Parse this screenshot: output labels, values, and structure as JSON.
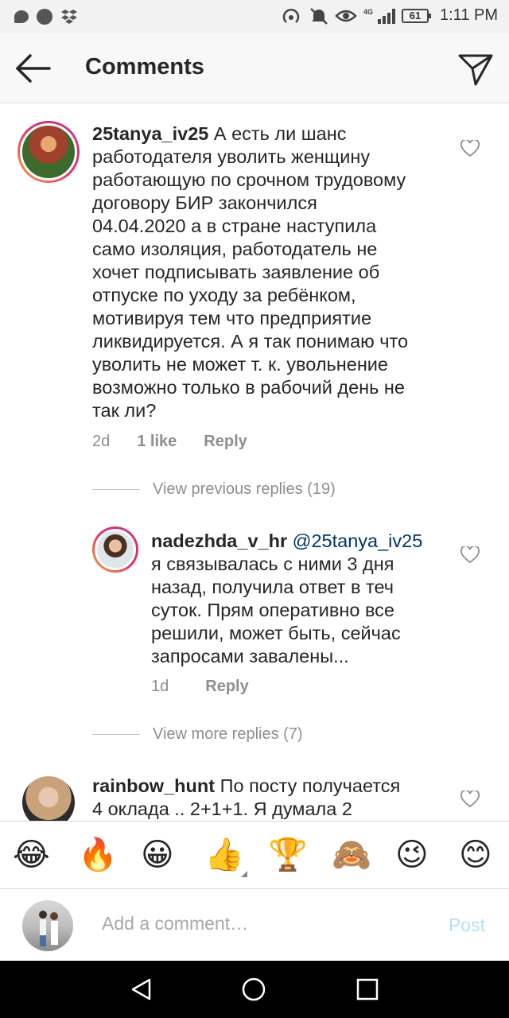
{
  "status_bar": {
    "time": "1:11 PM",
    "battery": "61",
    "network": "4G"
  },
  "header": {
    "title": "Comments",
    "back_icon": "arrow-left-icon",
    "send_icon": "paper-plane-icon"
  },
  "comments": [
    {
      "username": "25tanya_iv25",
      "text_lines": [
        "А есть ли шанс",
        "работодателя уволить женщину",
        "работающую по срочном трудовому",
        "договору БИР закончился",
        "04.04.2020 а в стране наступила",
        "само изоляция, работодатель не",
        "хочет подписывать заявление об",
        "отпуске  по уходу за ребёнком,",
        "мотивируя тем что предприятие",
        "ликвидируется. А я так понимаю что",
        "уволить не может т. к. увольнение",
        "возможно только в рабочий день не",
        "так ли?"
      ],
      "time": "2d",
      "likes": "1 like",
      "reply": "Reply"
    }
  ],
  "view_previous": "View previous replies (19)",
  "reply_comment": {
    "username": "nadezhda_v_hr",
    "mention": "@25tanya_iv25",
    "text_lines": [
      "я связывалась с ними 3 дня",
      "назад, получила ответ в теч",
      "суток. Прям оперативно все",
      "решили, может быть, сейчас",
      "запросами завалены..."
    ],
    "time": "1d",
    "reply": "Reply"
  },
  "view_more": "View more replies (7)",
  "third_comment": {
    "username": "rainbow_hunt",
    "text_lines": [
      "По посту получается",
      "4 оклада .. 2+1+1. Я думала 2"
    ]
  },
  "emojis": [
    "😂",
    "🔥",
    "😀",
    "👍",
    "🏆",
    "🙈",
    "😉",
    "😊"
  ],
  "composer": {
    "placeholder": "Add a comment…",
    "post_label": "Post"
  },
  "colors": {
    "accent_blue_disabled": "#b2dffc",
    "mention": "#003569",
    "meta_gray": "#8e8e8e"
  }
}
